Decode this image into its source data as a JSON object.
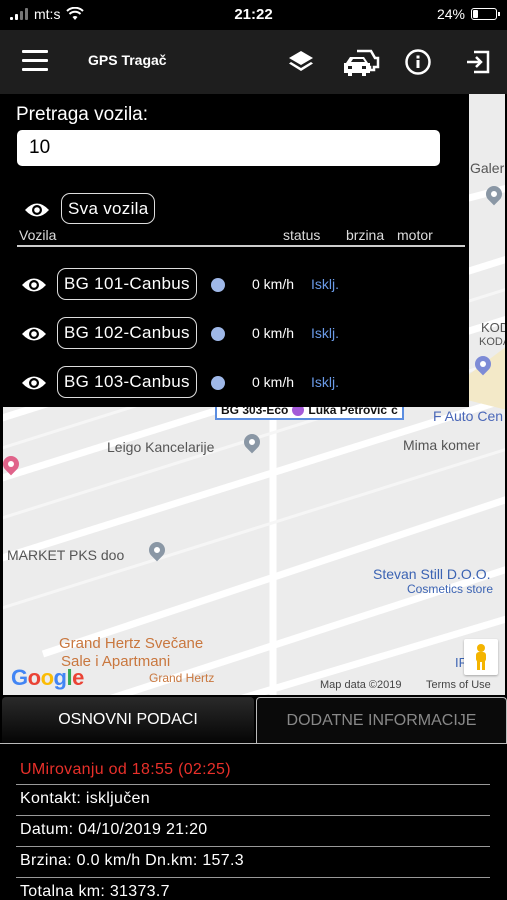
{
  "status_bar": {
    "carrier": "mt:s",
    "time": "21:22",
    "battery_percent": "24%",
    "battery_level": 0.24
  },
  "app_bar": {
    "title": "GPS Tragač",
    "icons": [
      "menu-icon",
      "layers-icon",
      "cars-icon",
      "info-icon",
      "logout-icon"
    ]
  },
  "search": {
    "label": "Pretraga vozila:",
    "value": "10"
  },
  "vehicle_list": {
    "all_vehicles_button": "Sva vozila",
    "headers": {
      "vehicles": "Vozila",
      "status": "status",
      "speed": "brzina",
      "engine": "motor"
    },
    "rows": [
      {
        "name": "BG 101-Canbus",
        "speed": "0 km/h",
        "engine": "Isklj."
      },
      {
        "name": "BG 102-Canbus",
        "speed": "0 km/h",
        "engine": "Isklj."
      },
      {
        "name": "BG 103-Canbus",
        "speed": "0 km/h",
        "engine": "Isklj."
      }
    ],
    "status_color": "#9fb8e8",
    "engine_color": "#6b9be8"
  },
  "map": {
    "places": {
      "galeri": "Galeri",
      "koda1": "KOD",
      "koda2": "KODA",
      "auto_center": "F Auto Cen",
      "leigo": "Leigo Kancelarije",
      "mima": "Mima komer",
      "market": "MARKET PKS doo",
      "stevan": "Stevan Still D.O.O.",
      "cosmetics": "Cosmetics store",
      "grand_hertz": "Grand Hertz Svečane",
      "sale": "Sale i Apartmani",
      "grand_hertz_small": "Grand Hertz",
      "ir": "IR"
    },
    "vehicle_label": "BG 303-Eco",
    "driver": "Luka Petrović",
    "driver_suffix": "c",
    "google": "Google",
    "map_data": "Map data ©2019",
    "terms": "Terms of Use"
  },
  "tabs": {
    "basic": "OSNOVNI PODACI",
    "additional": "DODATNE INFORMACIJE"
  },
  "info": {
    "resting": "UMirovanju od  18:55 (02:25)",
    "contact": "Kontakt: isključen",
    "date": "Datum: 04/10/2019 21:20",
    "speed": "Brzina: 0.0 km/h  Dn.km: 157.3",
    "total_km": "Totalna km: 31373.7"
  },
  "colors": {
    "appbar_bg": "#1e1e1e",
    "resting_red": "#e8302a",
    "map_bg": "#ececec"
  }
}
